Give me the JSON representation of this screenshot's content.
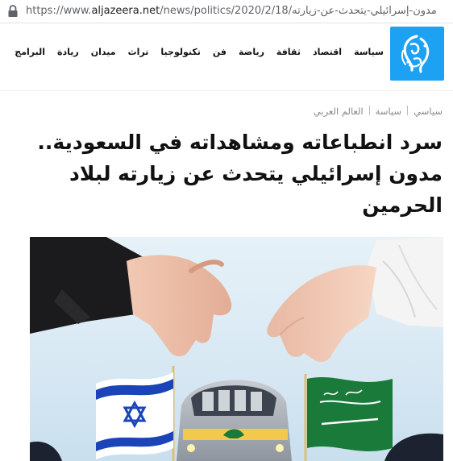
{
  "browser": {
    "url_prefix": "https://www.",
    "url_host": "aljazeera.net",
    "url_path": "/news/politics/2020/2/18/مدون-إسرائيلي-يتحدث-عن-زيارته"
  },
  "header": {
    "logo_icon": "aljazeera-logo-icon",
    "nav_items": [
      "سياسة",
      "اقتصاد",
      "ثقافة",
      "رياضة",
      "فن",
      "تكنولوجيا",
      "تراث",
      "ميدان",
      "ريادة",
      "البرامج"
    ]
  },
  "breadcrumb": [
    "سياسي",
    "سياسة",
    "العالم العربي"
  ],
  "article": {
    "title": "سرد انطباعاته ومشاهداته في السعودية.. مدون إسرائيلي يتحدث عن زيارته لبلاد الحرمين"
  },
  "colors": {
    "logo_bg": "#1da1f2",
    "text": "#111111",
    "crumb": "#888888"
  }
}
